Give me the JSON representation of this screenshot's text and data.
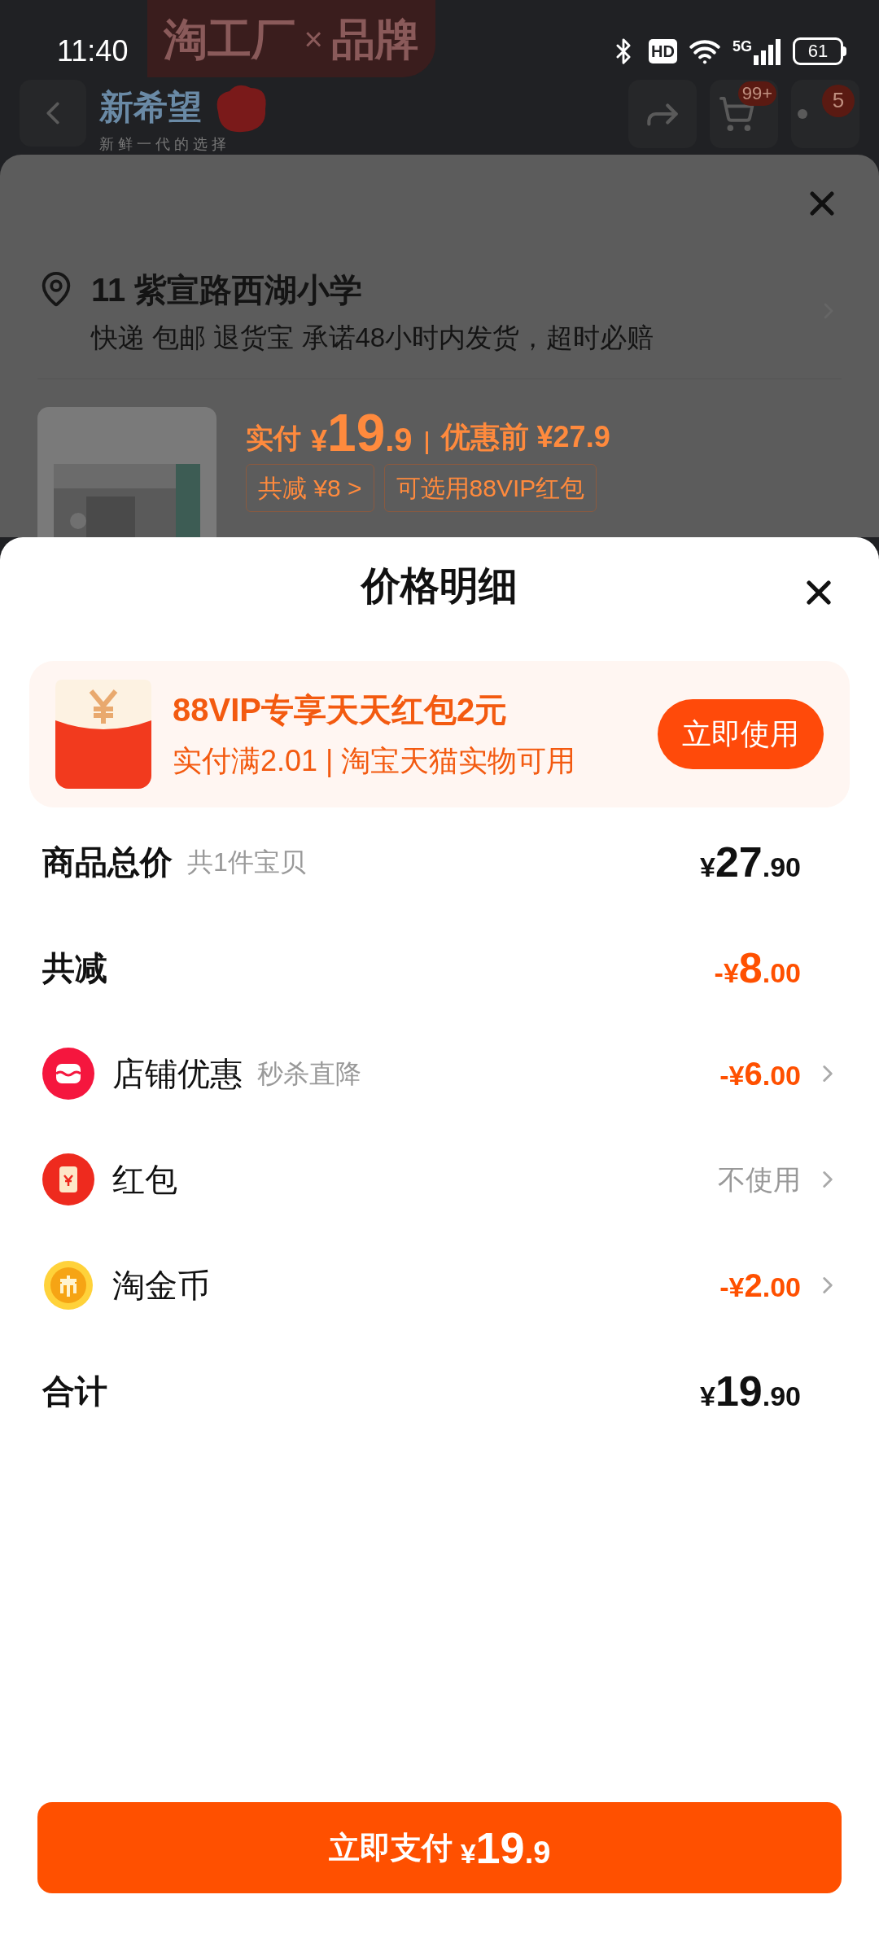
{
  "status_bar": {
    "time": "11:40",
    "hd": "HD",
    "network": "5G",
    "battery": "61"
  },
  "background_page": {
    "banner": {
      "left": "淘工厂",
      "sep": "×",
      "right": "品牌"
    },
    "brand_logo": {
      "name": "新希望",
      "slogan": "新 鲜 一 代 的 选 择"
    },
    "cart_badge": "99+",
    "more_badge": "5",
    "address": {
      "title": "11 紫宣路西湖小学",
      "detail": "快递 包邮 退货宝 承诺48小时内发货，超时必赔"
    },
    "product": {
      "kind": "picture",
      "paid_label": "实付",
      "currency": "¥",
      "price_integer": "19",
      "price_decimal": ".9",
      "original_price": "优惠前 ¥27.9",
      "tags": [
        "共减 ¥8 >",
        "可选用88VIP红包"
      ]
    }
  },
  "sheet": {
    "title": "价格明细",
    "promo": {
      "title": "88VIP专享天天红包2元",
      "subtitle": "实付满2.01 | 淘宝天猫实物可用",
      "button": "立即使用"
    },
    "rows": [
      {
        "kind": "total",
        "label": "商品总价",
        "note": "共1件宝贝",
        "amount": {
          "currency": "¥",
          "integer": "27",
          "decimal": ".90"
        },
        "arrow": false
      },
      {
        "kind": "discount_total",
        "label": "共减",
        "amount": {
          "sign": "-",
          "currency": "¥",
          "integer": "8",
          "decimal": ".00"
        },
        "arrow": false
      },
      {
        "kind": "store",
        "label": "店铺优惠",
        "note": "秒杀直降",
        "amount": {
          "sign": "-",
          "currency": "¥",
          "integer": "6",
          "decimal": ".00"
        },
        "arrow": true
      },
      {
        "kind": "red_packet",
        "label": "红包",
        "value": "不使用",
        "arrow": true
      },
      {
        "kind": "coin",
        "label": "淘金币",
        "amount": {
          "sign": "-",
          "currency": "¥",
          "integer": "2",
          "decimal": ".00"
        },
        "arrow": true
      },
      {
        "kind": "total",
        "label": "合计",
        "amount": {
          "currency": "¥",
          "integer": "19",
          "decimal": ".90"
        },
        "arrow": false
      }
    ],
    "pay_button": {
      "label": "立即支付",
      "currency": "¥",
      "integer": "19",
      "decimal": ".9"
    }
  }
}
